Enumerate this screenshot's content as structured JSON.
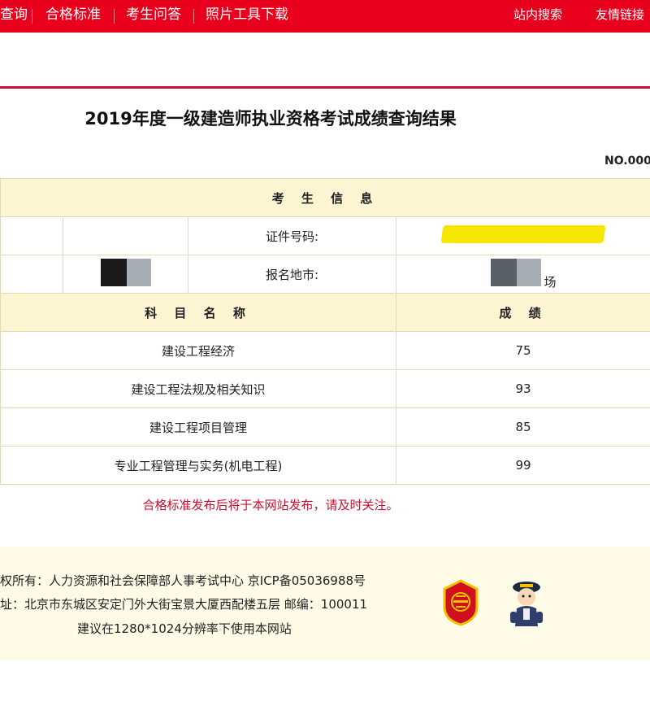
{
  "nav": {
    "items": [
      "查询",
      "合格标准",
      "考生问答",
      "照片工具下载"
    ],
    "right_items": [
      "站内搜索",
      "友情链接"
    ]
  },
  "page": {
    "title": "2019年度一级建造师执业资格考试成绩查询结果",
    "serial": "NO.000"
  },
  "table": {
    "section_header": "考 生 信 息",
    "rows": [
      {
        "label": "证件号码:",
        "value": ""
      },
      {
        "label": "报名地市:",
        "value": "场"
      }
    ],
    "score_headers": [
      "科 目 名 称",
      "成 绩"
    ],
    "scores": [
      {
        "subject": "建设工程经济",
        "score": "75"
      },
      {
        "subject": "建设工程法规及相关知识",
        "score": "93"
      },
      {
        "subject": "建设工程项目管理",
        "score": "85"
      },
      {
        "subject": "专业工程管理与实务(机电工程)",
        "score": "99"
      }
    ]
  },
  "notice": "合格标准发布后将于本网站发布，请及时关注。",
  "footer": {
    "line1": "权所有：人力资源和社会保障部人事考试中心 京ICP备05036988号",
    "line2": "址：北京市东城区安定门外大街宝景大厦西配楼五层 邮编：100011",
    "line3": "建议在1280*1024分辨率下使用本网站"
  },
  "colors": {
    "nav_bg": "#e8001c",
    "band_bg": "#fdf4d2",
    "notice": "#c8102e",
    "footer_bg": "#fffbe6"
  },
  "icons": [
    "emblem-icon",
    "police-icon"
  ]
}
